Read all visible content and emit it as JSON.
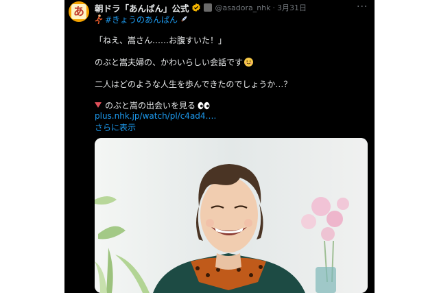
{
  "account": {
    "display_name": "朝ドラ「あんぱん」公式",
    "handle": "@asadora_nhk",
    "separator": "·",
    "date": "3月31日",
    "avatar_glyph": "あ",
    "verified_icon": "verified-badge-icon",
    "affiliation_icon": "government-affiliation-icon"
  },
  "tweet": {
    "hashtag": "#きょうのあんぱん",
    "line1": "「ねえ、嵩さん……お腹すいた！」",
    "line2": "のぶと嵩夫婦の、かわいらしい会話です",
    "line3": "二人はどのような人生を歩んできたのでしょうか…？",
    "line4": "のぶと嵩の出会いを見る",
    "link": "plus.nhk.jp/watch/pl/c4ad4….",
    "show_more": "さらに表示"
  },
  "more_menu_label": "···",
  "colors": {
    "background": "#000000",
    "text": "#e7e9ea",
    "muted": "#71767b",
    "link": "#1d9bf0",
    "verified": "#f4b400"
  }
}
